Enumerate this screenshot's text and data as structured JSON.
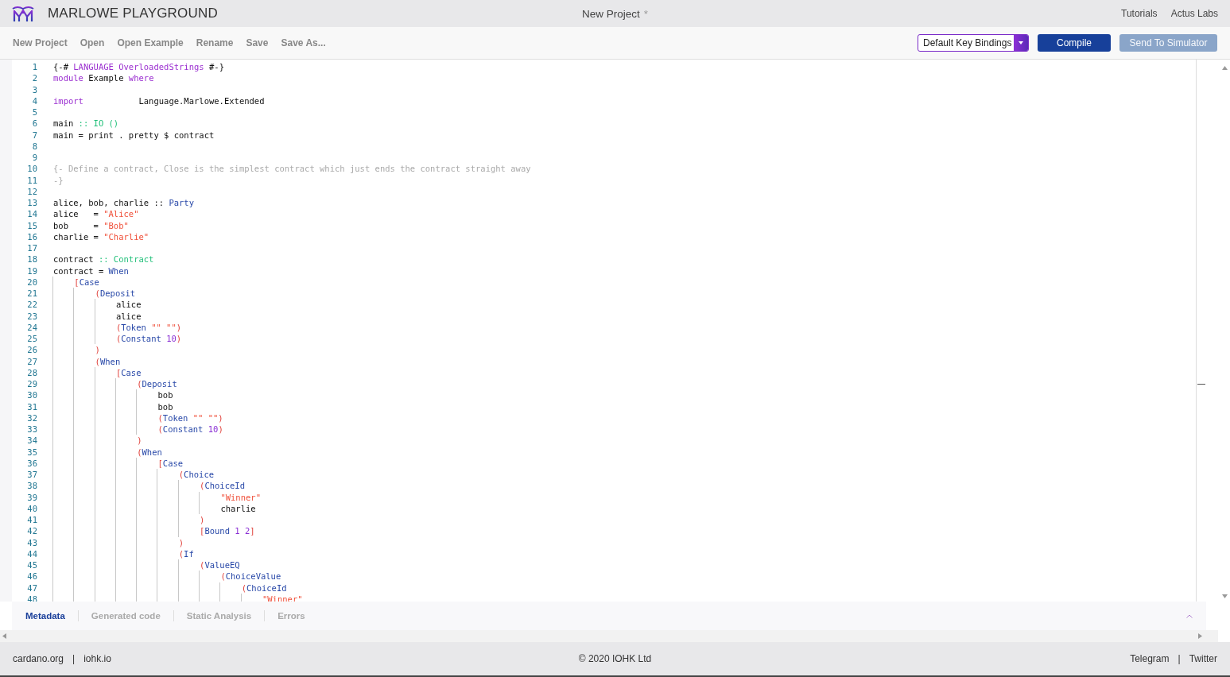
{
  "header": {
    "app_name": "MARLOWE PLAYGROUND",
    "project_title": "New Project",
    "unsaved_mark": "*",
    "links": [
      "Tutorials",
      "Actus Labs"
    ]
  },
  "toolbar": {
    "menu": [
      "New Project",
      "Open",
      "Open Example",
      "Rename",
      "Save",
      "Save As..."
    ],
    "key_bindings": "Default Key Bindings",
    "buttons": [
      {
        "label": "Compile",
        "disabled": false
      },
      {
        "label": "Send To Simulator",
        "disabled": true
      }
    ]
  },
  "editor": {
    "lines": [
      {
        "number": "1",
        "tokens": [
          {
            "kind": "plain",
            "text": "{-# "
          },
          {
            "kind": "keyword",
            "text": "LANGUAGE OverloadedStrings"
          },
          {
            "kind": "plain",
            "text": " #-}"
          }
        ]
      },
      {
        "number": "2",
        "tokens": [
          {
            "kind": "keyword",
            "text": "module"
          },
          {
            "kind": "plain",
            "text": " Example "
          },
          {
            "kind": "keyword",
            "text": "where"
          }
        ]
      },
      {
        "number": "3"
      },
      {
        "number": "4",
        "tokens": [
          {
            "kind": "keyword",
            "text": "import"
          },
          {
            "kind": "plain",
            "text": "           Language.Marlowe.Extended"
          }
        ]
      },
      {
        "number": "5"
      },
      {
        "number": "6",
        "tokens": [
          {
            "kind": "plain",
            "text": "main "
          },
          {
            "kind": "type",
            "text": ":: IO ()"
          }
        ]
      },
      {
        "number": "7",
        "tokens": [
          {
            "kind": "plain",
            "text": "main = print . pretty $ contract"
          }
        ]
      },
      {
        "number": "8"
      },
      {
        "number": "9"
      },
      {
        "number": "10",
        "tokens": [
          {
            "kind": "comment",
            "text": "{- Define a contract, Close is the simplest contract which just ends the contract straight away"
          }
        ]
      },
      {
        "number": "11",
        "tokens": [
          {
            "kind": "comment",
            "text": "-}"
          }
        ]
      },
      {
        "number": "12"
      },
      {
        "number": "13",
        "tokens": [
          {
            "kind": "plain",
            "text": "alice, bob, charlie :: "
          },
          {
            "kind": "constructor",
            "text": "Party"
          }
        ]
      },
      {
        "number": "14",
        "tokens": [
          {
            "kind": "plain",
            "text": "alice   = "
          },
          {
            "kind": "string",
            "text": "\"Alice\""
          }
        ]
      },
      {
        "number": "15",
        "tokens": [
          {
            "kind": "plain",
            "text": "bob     = "
          },
          {
            "kind": "string",
            "text": "\"Bob\""
          }
        ]
      },
      {
        "number": "16",
        "tokens": [
          {
            "kind": "plain",
            "text": "charlie = "
          },
          {
            "kind": "string",
            "text": "\"Charlie\""
          }
        ]
      },
      {
        "number": "17"
      },
      {
        "number": "18",
        "tokens": [
          {
            "kind": "plain",
            "text": "contract "
          },
          {
            "kind": "type",
            "text": ":: Contract"
          }
        ]
      },
      {
        "number": "19",
        "tokens": [
          {
            "kind": "plain",
            "text": "contract = "
          },
          {
            "kind": "constructor",
            "text": "When"
          }
        ]
      },
      {
        "number": "20",
        "tokens": [
          {
            "kind": "bracket",
            "text": "    ["
          },
          {
            "kind": "constructor",
            "text": "Case"
          }
        ]
      },
      {
        "number": "21",
        "tokens": [
          {
            "kind": "bracket",
            "text": "        ("
          },
          {
            "kind": "constructor",
            "text": "Deposit"
          }
        ]
      },
      {
        "number": "22",
        "tokens": [
          {
            "kind": "plain",
            "text": "            alice"
          }
        ]
      },
      {
        "number": "23",
        "tokens": [
          {
            "kind": "plain",
            "text": "            alice"
          }
        ]
      },
      {
        "number": "24",
        "tokens": [
          {
            "kind": "bracket",
            "text": "            ("
          },
          {
            "kind": "constructor",
            "text": "Token "
          },
          {
            "kind": "string",
            "text": "\"\" \"\""
          },
          {
            "kind": "bracket",
            "text": ")"
          }
        ]
      },
      {
        "number": "25",
        "tokens": [
          {
            "kind": "bracket",
            "text": "            ("
          },
          {
            "kind": "constructor",
            "text": "Constant "
          },
          {
            "kind": "number",
            "text": "10"
          },
          {
            "kind": "bracket",
            "text": ")"
          }
        ]
      },
      {
        "number": "26",
        "tokens": [
          {
            "kind": "bracket",
            "text": "        )"
          }
        ]
      },
      {
        "number": "27",
        "tokens": [
          {
            "kind": "bracket",
            "text": "        ("
          },
          {
            "kind": "constructor",
            "text": "When"
          }
        ]
      },
      {
        "number": "28",
        "tokens": [
          {
            "kind": "bracket",
            "text": "            ["
          },
          {
            "kind": "constructor",
            "text": "Case"
          }
        ]
      },
      {
        "number": "29",
        "tokens": [
          {
            "kind": "bracket",
            "text": "                ("
          },
          {
            "kind": "constructor",
            "text": "Deposit"
          }
        ]
      },
      {
        "number": "30",
        "tokens": [
          {
            "kind": "plain",
            "text": "                    bob"
          }
        ]
      },
      {
        "number": "31",
        "tokens": [
          {
            "kind": "plain",
            "text": "                    bob"
          }
        ]
      },
      {
        "number": "32",
        "tokens": [
          {
            "kind": "bracket",
            "text": "                    ("
          },
          {
            "kind": "constructor",
            "text": "Token "
          },
          {
            "kind": "string",
            "text": "\"\" \"\""
          },
          {
            "kind": "bracket",
            "text": ")"
          }
        ]
      },
      {
        "number": "33",
        "tokens": [
          {
            "kind": "bracket",
            "text": "                    ("
          },
          {
            "kind": "constructor",
            "text": "Constant "
          },
          {
            "kind": "number",
            "text": "10"
          },
          {
            "kind": "bracket",
            "text": ")"
          }
        ]
      },
      {
        "number": "34",
        "tokens": [
          {
            "kind": "bracket",
            "text": "                )"
          }
        ]
      },
      {
        "number": "35",
        "tokens": [
          {
            "kind": "bracket",
            "text": "                ("
          },
          {
            "kind": "constructor",
            "text": "When"
          }
        ]
      },
      {
        "number": "36",
        "tokens": [
          {
            "kind": "bracket",
            "text": "                    ["
          },
          {
            "kind": "constructor",
            "text": "Case"
          }
        ]
      },
      {
        "number": "37",
        "tokens": [
          {
            "kind": "bracket",
            "text": "                        ("
          },
          {
            "kind": "constructor",
            "text": "Choice"
          }
        ]
      },
      {
        "number": "38",
        "tokens": [
          {
            "kind": "bracket",
            "text": "                            ("
          },
          {
            "kind": "constructor",
            "text": "ChoiceId"
          }
        ]
      },
      {
        "number": "39",
        "tokens": [
          {
            "kind": "string",
            "text": "                                \"Winner\""
          }
        ]
      },
      {
        "number": "40",
        "tokens": [
          {
            "kind": "plain",
            "text": "                                charlie"
          }
        ]
      },
      {
        "number": "41",
        "tokens": [
          {
            "kind": "bracket",
            "text": "                            )"
          }
        ]
      },
      {
        "number": "42",
        "tokens": [
          {
            "kind": "bracket",
            "text": "                            ["
          },
          {
            "kind": "constructor",
            "text": "Bound "
          },
          {
            "kind": "number",
            "text": "1 2"
          },
          {
            "kind": "bracket",
            "text": "]"
          }
        ]
      },
      {
        "number": "43",
        "tokens": [
          {
            "kind": "bracket",
            "text": "                        )"
          }
        ]
      },
      {
        "number": "44",
        "tokens": [
          {
            "kind": "bracket",
            "text": "                        ("
          },
          {
            "kind": "constructor",
            "text": "If"
          }
        ]
      },
      {
        "number": "45",
        "tokens": [
          {
            "kind": "bracket",
            "text": "                            ("
          },
          {
            "kind": "constructor",
            "text": "ValueEQ"
          }
        ]
      },
      {
        "number": "46",
        "tokens": [
          {
            "kind": "bracket",
            "text": "                                ("
          },
          {
            "kind": "constructor",
            "text": "ChoiceValue"
          }
        ]
      },
      {
        "number": "47",
        "tokens": [
          {
            "kind": "bracket",
            "text": "                                    ("
          },
          {
            "kind": "constructor",
            "text": "ChoiceId"
          }
        ]
      },
      {
        "number": "48",
        "tokens": [
          {
            "kind": "string",
            "text": "                                        \"Winner\""
          }
        ]
      }
    ]
  },
  "bottom_panel": {
    "tabs": [
      {
        "label": "Metadata",
        "selected": true
      },
      {
        "label": "Generated code",
        "selected": false
      },
      {
        "label": "Static Analysis",
        "selected": false
      },
      {
        "label": "Errors",
        "selected": false
      }
    ]
  },
  "footer": {
    "left_links": [
      "cardano.org",
      "iohk.io"
    ],
    "separator": "|",
    "copyright": "© 2020 IOHK Ltd",
    "right_links": [
      "Telegram",
      "Twitter"
    ]
  }
}
